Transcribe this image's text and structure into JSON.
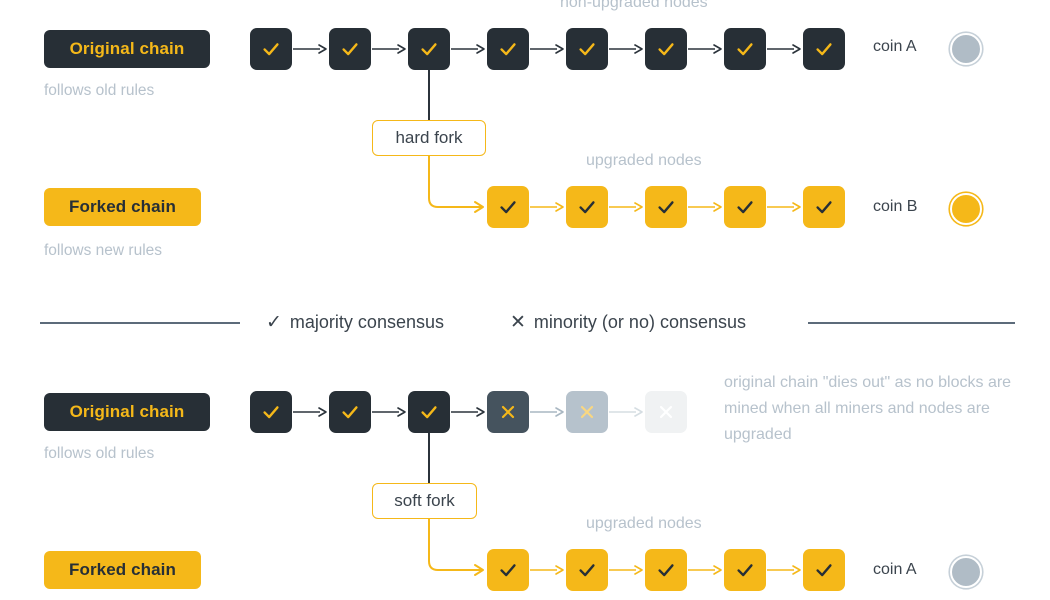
{
  "sections": [
    {
      "id": "hard-fork",
      "original": {
        "tag": "Original chain",
        "sub": "follows old rules",
        "caption": "non-upgraded nodes",
        "coin_label": "coin A",
        "coin_style": "grey",
        "block_count": 8,
        "block_mark": "check"
      },
      "fork_label": "hard fork",
      "forked": {
        "tag": "Forked chain",
        "sub": "follows new rules",
        "caption": "upgraded nodes",
        "coin_label": "coin B",
        "coin_style": "gold",
        "block_count": 5,
        "block_mark": "check"
      }
    },
    {
      "id": "soft-fork",
      "original": {
        "tag": "Original chain",
        "sub": "follows old rules",
        "caption": "",
        "coin_label": "",
        "coin_style": "",
        "block_count": 3,
        "block_mark": "check",
        "dead_blocks": 3,
        "note": "original chain \"dies out\" as no blocks are mined when all miners and nodes are upgraded"
      },
      "fork_label": "soft fork",
      "forked": {
        "tag": "Forked chain",
        "sub": "",
        "caption": "upgraded nodes",
        "coin_label": "coin A",
        "coin_style": "grey",
        "block_count": 5,
        "block_mark": "check"
      }
    }
  ],
  "legend": {
    "majority": "majority consensus",
    "minority": "minority (or no) consensus",
    "check_glyph": "✓",
    "cross_glyph": "✕"
  },
  "colors": {
    "dark": "#272f36",
    "gold": "#f5b819",
    "muted": "#b7c2cc",
    "text": "#3b444d",
    "arrow_dark": "#2b333b",
    "arrow_gold": "#f5b819",
    "arrow_fade": "#aab8c4",
    "coin_grey": "#b0bcc6"
  }
}
